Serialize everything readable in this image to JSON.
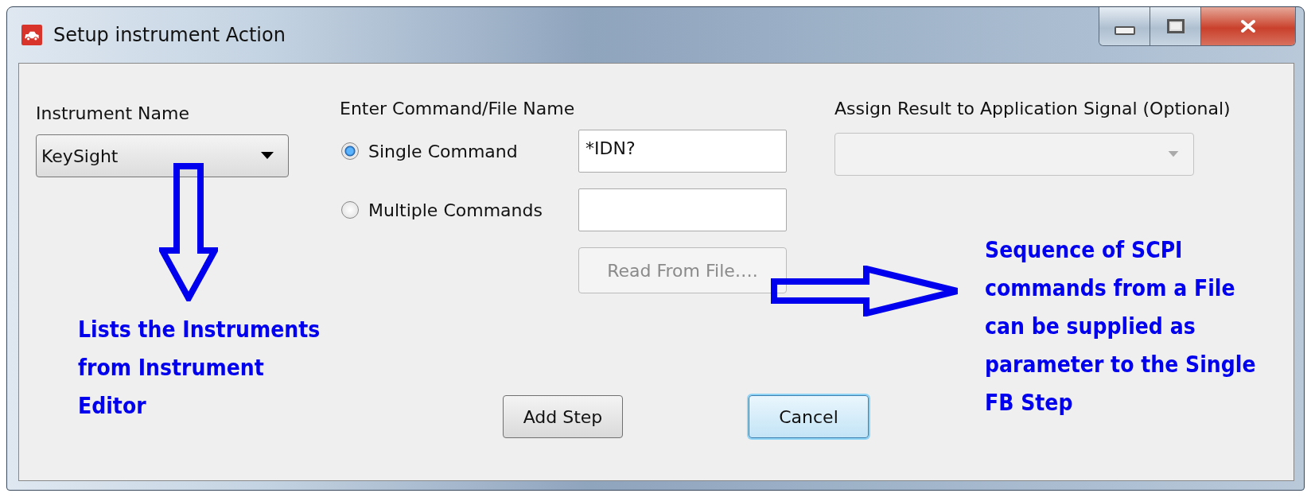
{
  "window": {
    "title": "Setup instrument Action"
  },
  "instrument": {
    "label": "Instrument Name",
    "value": "KeySight"
  },
  "command": {
    "label": "Enter Command/File Name",
    "options": [
      {
        "label": "Single Command",
        "selected": true,
        "value": "*IDN?"
      },
      {
        "label": "Multiple Commands",
        "selected": false
      }
    ],
    "read_button": {
      "label": "Read From File….",
      "disabled": true
    }
  },
  "assign": {
    "label": "Assign Result to Application Signal (Optional)",
    "disabled": true
  },
  "buttons": [
    {
      "label": "Add Step",
      "default": false
    },
    {
      "label": "Cancel",
      "default": true
    }
  ],
  "annotations": [
    {
      "kind": "down",
      "lines": [
        "Lists the Instruments",
        "from Instrument",
        "Editor"
      ]
    },
    {
      "kind": "right",
      "lines": [
        "Sequence of SCPI",
        "commands from a File",
        "can be supplied as",
        "parameter to the Single",
        "FB Step"
      ]
    }
  ]
}
